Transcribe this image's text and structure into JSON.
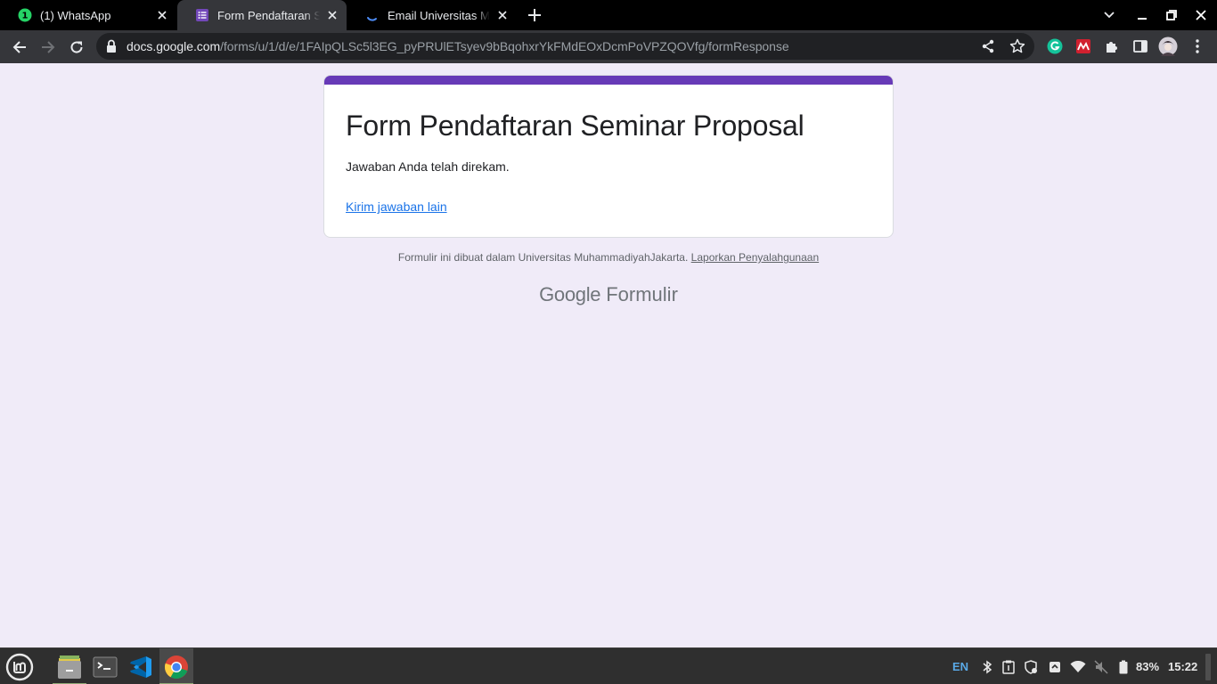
{
  "browser": {
    "tabs": [
      {
        "title": "(1) WhatsApp",
        "favicon": "whatsapp-icon",
        "badge": "1",
        "active": false
      },
      {
        "title": "Form Pendaftaran Seminar Proposal",
        "favicon": "google-forms-icon",
        "active": true
      },
      {
        "title": "Email Universitas Muhammadiyah Jakarta",
        "favicon": "loading-spinner-icon",
        "active": false
      }
    ],
    "url": {
      "host": "docs.google.com",
      "path": "/forms/u/1/d/e/1FAIpQLSc5l3EG_pyPRUlETsyev9bBqohxrYkFMdEOxDcmPoVPZQOVfg/formResponse"
    },
    "extensions": [
      "grammarly-icon",
      "red-extension-icon",
      "puzzle-icon",
      "side-panel-icon",
      "profile-avatar"
    ]
  },
  "page": {
    "form_title": "Form Pendaftaran Seminar Proposal",
    "confirmation": "Jawaban Anda telah direkam.",
    "another_response_link": "Kirim jawaban lain",
    "footer_text": "Formulir ini dibuat dalam Universitas MuhammadiyahJakarta.",
    "report_link": "Laporkan Penyalahgunaan",
    "brand_google": "Google",
    "brand_forms": "Formulir"
  },
  "taskbar": {
    "apps": [
      "files-icon",
      "terminal-icon",
      "vscode-icon",
      "chrome-icon"
    ],
    "keyboard_layout": "EN",
    "battery": "83%",
    "clock": "15:22"
  },
  "colors": {
    "form_accent": "#673ab7",
    "page_background": "#f0ebf8",
    "link": "#1a73e8"
  }
}
